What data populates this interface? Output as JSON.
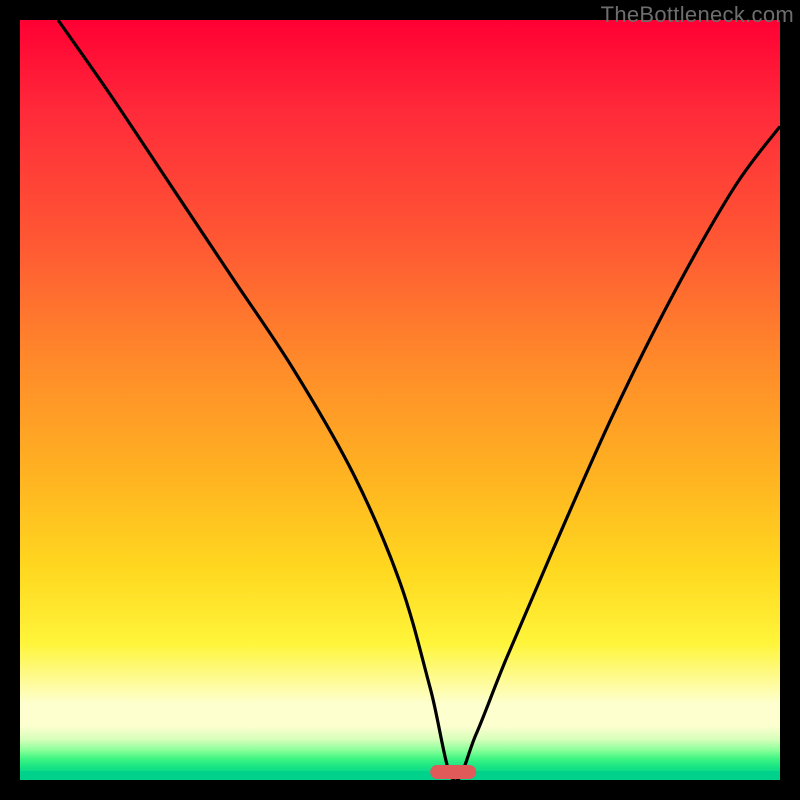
{
  "watermark": "TheBottleneck.com",
  "chart_data": {
    "type": "line",
    "title": "",
    "xlabel": "",
    "ylabel": "",
    "xlim": [
      0,
      100
    ],
    "ylim": [
      0,
      100
    ],
    "grid": false,
    "note": "Background vertical color gradient runs red (top, high bottleneck) to green (bottom, balanced). Curve is a V-shaped bottleneck profile reaching its minimum (~0) near x≈57.",
    "series": [
      {
        "name": "bottleneck-curve",
        "x": [
          5,
          12,
          20,
          28,
          36,
          44,
          50,
          54,
          57,
          60,
          64,
          70,
          78,
          86,
          94,
          100
        ],
        "y": [
          100,
          90,
          78,
          66,
          54,
          40,
          26,
          12,
          0,
          6,
          16,
          30,
          48,
          64,
          78,
          86
        ]
      }
    ],
    "optimal_marker": {
      "x": 57,
      "width_pct": 6
    }
  },
  "colors": {
    "gradient_top": "#ff0033",
    "gradient_mid": "#ffd71f",
    "gradient_bottom": "#00d28b",
    "curve": "#000000",
    "marker": "#e05a5a",
    "frame": "#000000",
    "watermark": "#6e6e6e"
  }
}
